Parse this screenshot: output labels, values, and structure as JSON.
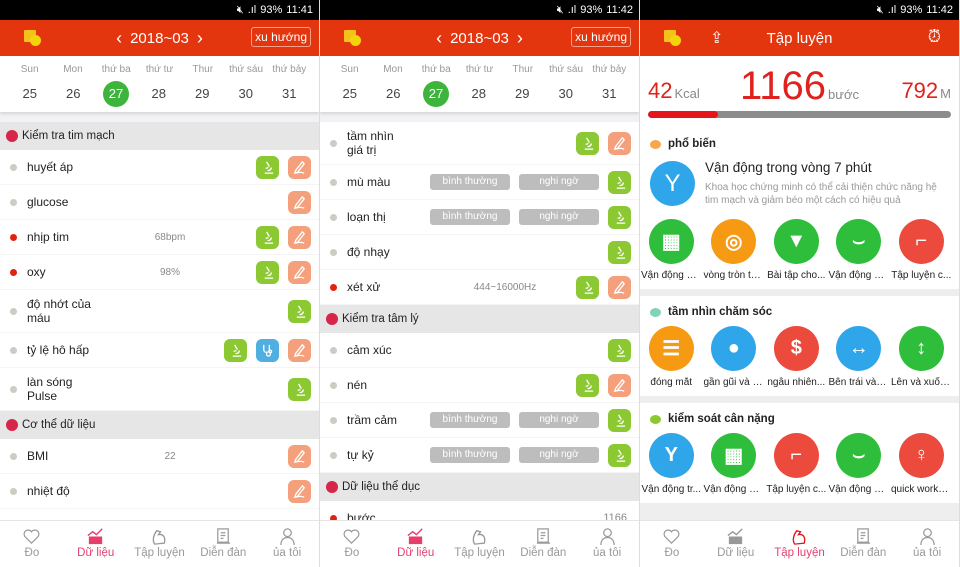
{
  "colors": {
    "header": "#e4360e",
    "selected_date": "#3db53d",
    "active_tab": "#e43f6f",
    "microscope": "#8cc832",
    "pen": "#f4a07c",
    "stethoscope": "#50aee0"
  },
  "panels": [
    {
      "status": {
        "battery": "93%",
        "time": "11:41"
      },
      "month": "2018~03",
      "trend": "xu hướng",
      "days": [
        "Sun",
        "Mon",
        "thứ ba",
        "thứ tư",
        "Thur",
        "thứ sáu",
        "thứ bảy"
      ],
      "dates": [
        "25",
        "26",
        "27",
        "28",
        "29",
        "30",
        "31"
      ],
      "selected": "27",
      "rows": [
        {
          "type": "section",
          "label": "Kiểm tra tim mạch",
          "icon": "heart-pulse-icon"
        },
        {
          "label": "huyết áp",
          "dot": "gray",
          "actions": [
            "microscope",
            "pen"
          ]
        },
        {
          "label": "glucose",
          "dot": "gray",
          "actions": [
            "pen"
          ]
        },
        {
          "label": "nhịp tim",
          "dot": "red",
          "value": "68bpm",
          "actions": [
            "microscope",
            "pen"
          ]
        },
        {
          "label": "oxy",
          "dot": "red",
          "value": "98%",
          "actions": [
            "microscope",
            "pen"
          ]
        },
        {
          "label": "độ nhớt của\nmáu",
          "dot": "gray",
          "actions": [
            "microscope"
          ]
        },
        {
          "label": "tỷ lệ hô hấp",
          "dot": "gray",
          "actions": [
            "microscope",
            "stethoscope",
            "pen"
          ]
        },
        {
          "label": "làn sóng\nPulse",
          "dot": "gray",
          "actions": [
            "microscope"
          ]
        },
        {
          "type": "section",
          "label": "Cơ thể dữ liệu",
          "icon": "body-icon"
        },
        {
          "label": "BMI",
          "dot": "gray",
          "value": "22",
          "actions": [
            "pen"
          ]
        },
        {
          "label": "nhiệt độ",
          "dot": "gray",
          "actions": [
            "pen"
          ]
        }
      ]
    },
    {
      "status": {
        "battery": "93%",
        "time": "11:42"
      },
      "month": "2018~03",
      "trend": "xu hướng",
      "days": [
        "Sun",
        "Mon",
        "thứ ba",
        "thứ tư",
        "Thur",
        "thứ sáu",
        "thứ bảy"
      ],
      "dates": [
        "25",
        "26",
        "27",
        "28",
        "29",
        "30",
        "31"
      ],
      "selected": "27",
      "rows": [
        {
          "label": "tầm nhìn\ngiá trị",
          "dot": "gray",
          "actions": [
            "microscope",
            "pen"
          ]
        },
        {
          "label": "mù màu",
          "dot": "gray",
          "choices": [
            "bình thường",
            "nghi ngờ"
          ],
          "actions": [
            "microscope"
          ]
        },
        {
          "label": "loạn thị",
          "dot": "gray",
          "choices": [
            "bình thường",
            "nghi ngờ"
          ],
          "actions": [
            "microscope"
          ]
        },
        {
          "label": "độ nhạy",
          "dot": "gray",
          "actions": [
            "microscope"
          ]
        },
        {
          "label": "xét xử",
          "dot": "red",
          "value": "444~16000Hz",
          "actions": [
            "microscope",
            "pen"
          ]
        },
        {
          "type": "section",
          "label": "Kiểm tra tâm lý",
          "icon": "head-icon"
        },
        {
          "label": "cảm xúc",
          "dot": "gray",
          "actions": [
            "microscope"
          ]
        },
        {
          "label": "nén",
          "dot": "gray",
          "actions": [
            "microscope",
            "pen"
          ]
        },
        {
          "label": "trầm cảm",
          "dot": "gray",
          "choices": [
            "bình thường",
            "nghi ngờ"
          ],
          "actions": [
            "microscope"
          ]
        },
        {
          "label": "tự kỷ",
          "dot": "gray",
          "choices": [
            "bình thường",
            "nghi ngờ"
          ],
          "actions": [
            "microscope"
          ]
        },
        {
          "type": "section",
          "label": "Dữ liệu thể dục",
          "icon": "muscle-icon"
        },
        {
          "label": "bước",
          "dot": "red",
          "value_right": "1166",
          "actions": []
        }
      ]
    },
    {
      "status": {
        "battery": "93%",
        "time": "11:42"
      },
      "title": "Tập luyện",
      "stats": {
        "kcal": "42",
        "kcal_unit": "Kcal",
        "steps": "1166",
        "steps_unit": "bước",
        "distance": "792",
        "distance_unit": "M",
        "progress_percent": 23
      },
      "cards": [
        {
          "title": "phổ biến",
          "icon_color": "#f7a64a",
          "feature": {
            "title": "Vận động trong vòng 7 phút",
            "desc": "Khoa học chứng minh có thể cải thiện chức năng hệ tim mạch và giảm béo một cách có hiệu quả",
            "color": "#2fa6ea"
          },
          "items": [
            {
              "label": "Vận động vù...",
              "color": "#2fbe3c",
              "icon": "abs-icon"
            },
            {
              "label": "vòng tròn tậ...",
              "color": "#f59a12",
              "icon": "target-icon"
            },
            {
              "label": "Bài tập cho...",
              "color": "#2fbe3c",
              "icon": "tie-icon"
            },
            {
              "label": "Vận động vù...",
              "color": "#2fbe3c",
              "icon": "waist-icon"
            },
            {
              "label": "Tập luyện c...",
              "color": "#ec4a3c",
              "icon": "leg-icon"
            }
          ]
        },
        {
          "title": "tầm nhìn chăm sóc",
          "icon_color": "#7fd3b8",
          "items": [
            {
              "label": "đóng mắt",
              "color": "#f59a12",
              "icon": "sunset-icon"
            },
            {
              "label": "gần gũi và d...",
              "color": "#2fa6ea",
              "icon": "eye-icon"
            },
            {
              "label": "ngẫu nhiên...",
              "color": "#ec4a3c",
              "icon": "random-icon"
            },
            {
              "label": "Bên trái và b...",
              "color": "#2fa6ea",
              "icon": "left-right-icon"
            },
            {
              "label": "Lên và xuống và",
              "color": "#2fbe3c",
              "icon": "up-down-icon"
            }
          ]
        },
        {
          "title": "kiểm soát cân nặng",
          "icon_color": "#8cc832",
          "items": [
            {
              "label": "Vận động tr...",
              "color": "#2fa6ea",
              "icon": "stretch-icon"
            },
            {
              "label": "Vận động vù...",
              "color": "#2fbe3c",
              "icon": "abs-icon"
            },
            {
              "label": "Tập luyện c...",
              "color": "#ec4a3c",
              "icon": "leg-icon"
            },
            {
              "label": "Vận động vù...",
              "color": "#2fbe3c",
              "icon": "waist-icon"
            },
            {
              "label": "quick worko...",
              "color": "#ec4a3c",
              "icon": "workout-icon"
            }
          ]
        }
      ]
    }
  ],
  "tabs": [
    {
      "label": "Đo",
      "icon": "heart-icon"
    },
    {
      "label": "Dữ liệu",
      "icon": "chart-icon"
    },
    {
      "label": "Tập luyện",
      "icon": "muscle-icon"
    },
    {
      "label": "Diễn đàn",
      "icon": "forum-icon"
    },
    {
      "label": "ủa tôi",
      "icon": "user-icon"
    }
  ],
  "active_tabs": [
    1,
    1,
    2
  ]
}
